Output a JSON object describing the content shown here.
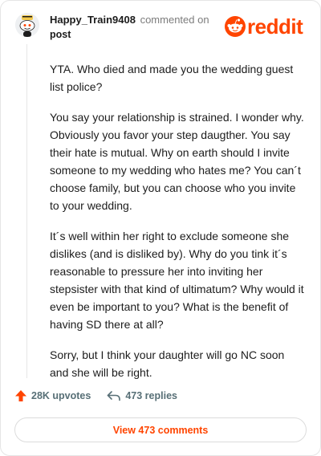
{
  "comment": {
    "username": "Happy_Train9408",
    "action": "commented on",
    "post_link": "post",
    "paragraphs": [
      "YTA. Who died and made you the wedding guest list police?",
      "You say your relationship is strained. I wonder why. Obviously you favor your step daugther. You say their hate is mutual. Why on earth should I invite someone to my wedding who hates me? You can´t choose family, but you can choose who you invite to your wedding.",
      "It´s well within her right to exclude someone she dislikes (and is disliked by). Why do you tink it´s reasonable to pressure her into inviting her stepsister with that kind of ultimatum? Why would it even be important to you? What is the benefit of having SD there at all?",
      "Sorry, but I think your daughter will go NC soon and she will be right."
    ]
  },
  "brand": {
    "wordmark": "reddit",
    "color": "#ff4500"
  },
  "stats": {
    "upvotes": "28K upvotes",
    "replies": "473 replies"
  },
  "footer": {
    "view_comments": "View 473 comments"
  }
}
